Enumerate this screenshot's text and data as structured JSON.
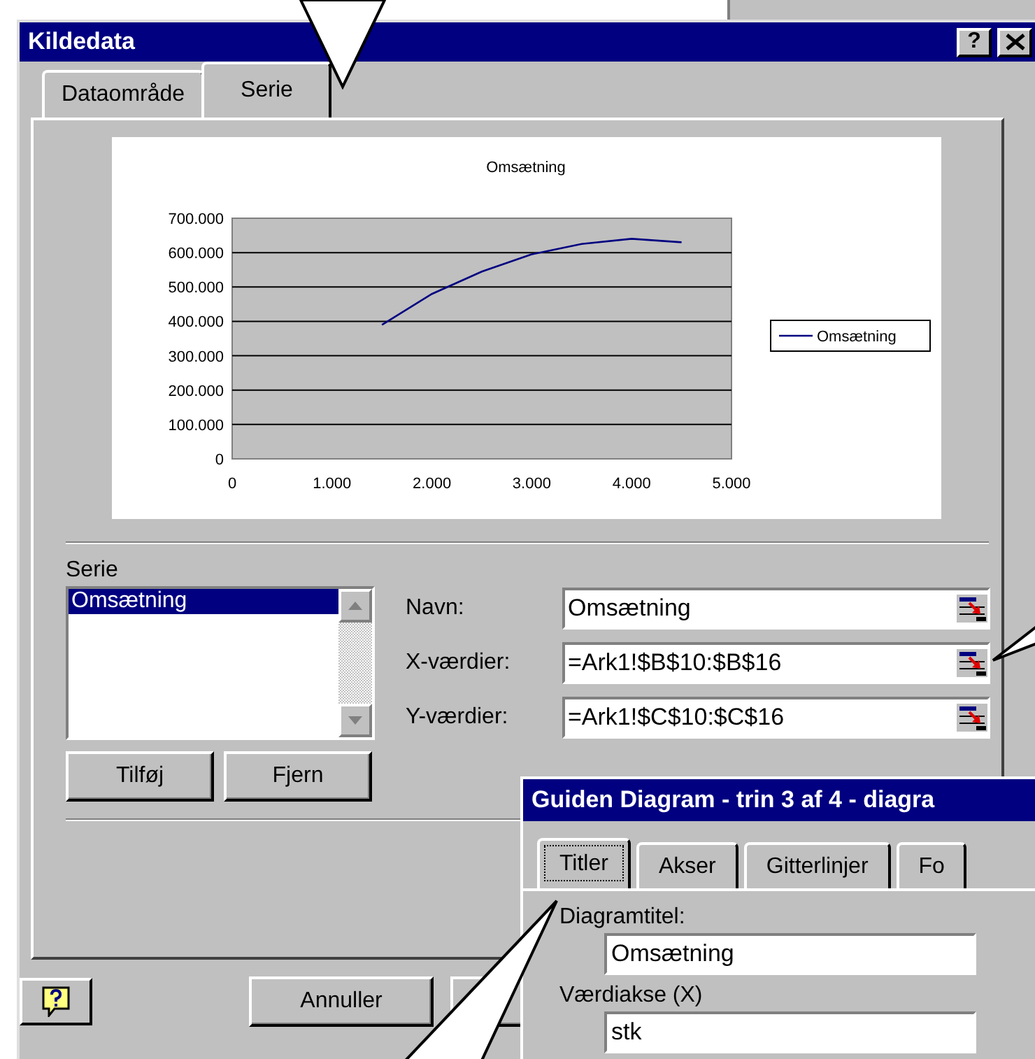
{
  "window": {
    "title": "Kildedata",
    "help_button": "?"
  },
  "tabs": [
    {
      "label": "Dataområde",
      "selected": false
    },
    {
      "label": "Serie",
      "selected": true
    }
  ],
  "chart_data": {
    "type": "line",
    "title": "Omsætning",
    "x": [
      1500,
      2000,
      2500,
      3000,
      3500,
      4000,
      4500
    ],
    "series": [
      {
        "name": "Omsætning",
        "color": "#000080",
        "values": [
          390000,
          480000,
          545000,
          595000,
          625000,
          640000,
          630000
        ]
      }
    ],
    "grid": true,
    "xlim": [
      0,
      5000
    ],
    "ylim": [
      0,
      700000
    ],
    "xticks": [
      {
        "value": 0,
        "label": "0"
      },
      {
        "value": 1000,
        "label": "1.000"
      },
      {
        "value": 2000,
        "label": "2.000"
      },
      {
        "value": 3000,
        "label": "3.000"
      },
      {
        "value": 4000,
        "label": "4.000"
      },
      {
        "value": 5000,
        "label": "5.000"
      }
    ],
    "yticks": [
      {
        "value": 0,
        "label": "0"
      },
      {
        "value": 100000,
        "label": "100.000"
      },
      {
        "value": 200000,
        "label": "200.000"
      },
      {
        "value": 300000,
        "label": "300.000"
      },
      {
        "value": 400000,
        "label": "400.000"
      },
      {
        "value": 500000,
        "label": "500.000"
      },
      {
        "value": 600000,
        "label": "600.000"
      },
      {
        "value": 700000,
        "label": "700.000"
      }
    ]
  },
  "series_list": {
    "label": "Serie",
    "items": [
      {
        "name": "Omsætning",
        "selected": true
      }
    ]
  },
  "series_buttons": [
    "Tilføj",
    "Fjern"
  ],
  "fields": [
    {
      "label": "Navn:",
      "value": "Omsætning"
    },
    {
      "label": "X-værdier:",
      "value": "=Ark1!$B$10:$B$16"
    },
    {
      "label": "Y-værdier:",
      "value": "=Ark1!$C$10:$C$16"
    }
  ],
  "footer_buttons": [
    "Annuller"
  ],
  "wizard": {
    "title": "Guiden Diagram - trin 3 af 4 - diagra",
    "tabs": [
      {
        "label": "Titler",
        "selected": true
      },
      {
        "label": "Akser",
        "selected": false
      },
      {
        "label": "Gitterlinjer",
        "selected": false
      },
      {
        "label": "Fo",
        "selected": false
      }
    ],
    "fields": [
      {
        "label": "Diagramtitel:",
        "value": "Omsætning"
      },
      {
        "label": "Værdiakse (X)",
        "value": "stk"
      }
    ]
  }
}
